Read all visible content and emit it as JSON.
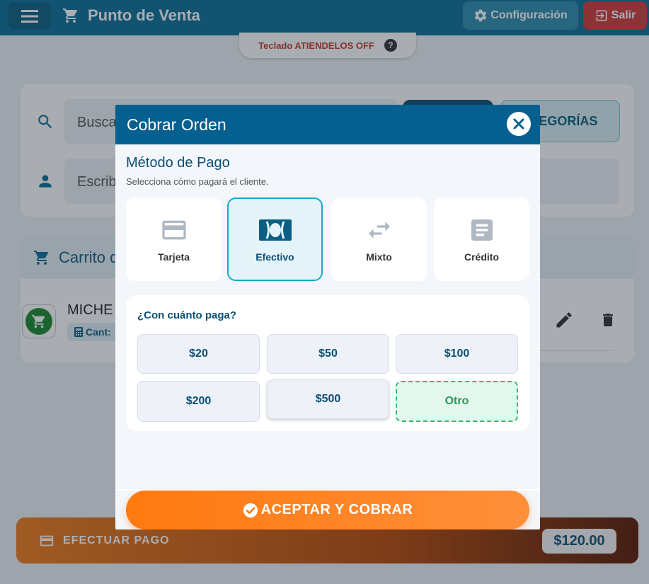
{
  "header": {
    "title": "Punto de Venta",
    "config_label": "Configuración",
    "exit_label": "Salir"
  },
  "keyboard_status": "Teclado ATIENDELOS OFF",
  "help_glyph": "?",
  "search": {
    "placeholder": "Busca",
    "client_placeholder": "Escrib",
    "categories_label": "ATEGORÍAS"
  },
  "cart": {
    "title": "Carrito d",
    "product_name": "MICHE",
    "qty_label": "Cant:"
  },
  "payment_bar": {
    "label": "EFECTUAR PAGO",
    "total": "$120.00"
  },
  "modal": {
    "title": "Cobrar Orden",
    "section_title": "Método de Pago",
    "section_subtitle": "Selecciona cómo pagará el cliente.",
    "methods": [
      {
        "label": "Tarjeta",
        "icon": "credit-card-icon"
      },
      {
        "label": "Efectivo",
        "icon": "cash-icon",
        "selected": true
      },
      {
        "label": "Mixto",
        "icon": "swap-arrows-icon"
      },
      {
        "label": "Crédito",
        "icon": "document-icon"
      }
    ],
    "cash_question": "¿Con cuánto paga?",
    "amounts": [
      "$20",
      "$50",
      "$100",
      "$200",
      "$500",
      "Otro"
    ],
    "accept_label": "ACEPTAR Y COBRAR"
  },
  "colors": {
    "primary": "#06608f",
    "accent_orange": "#ff7a10",
    "selected_border": "#18a8c8",
    "other_green": "#2cbf72"
  }
}
